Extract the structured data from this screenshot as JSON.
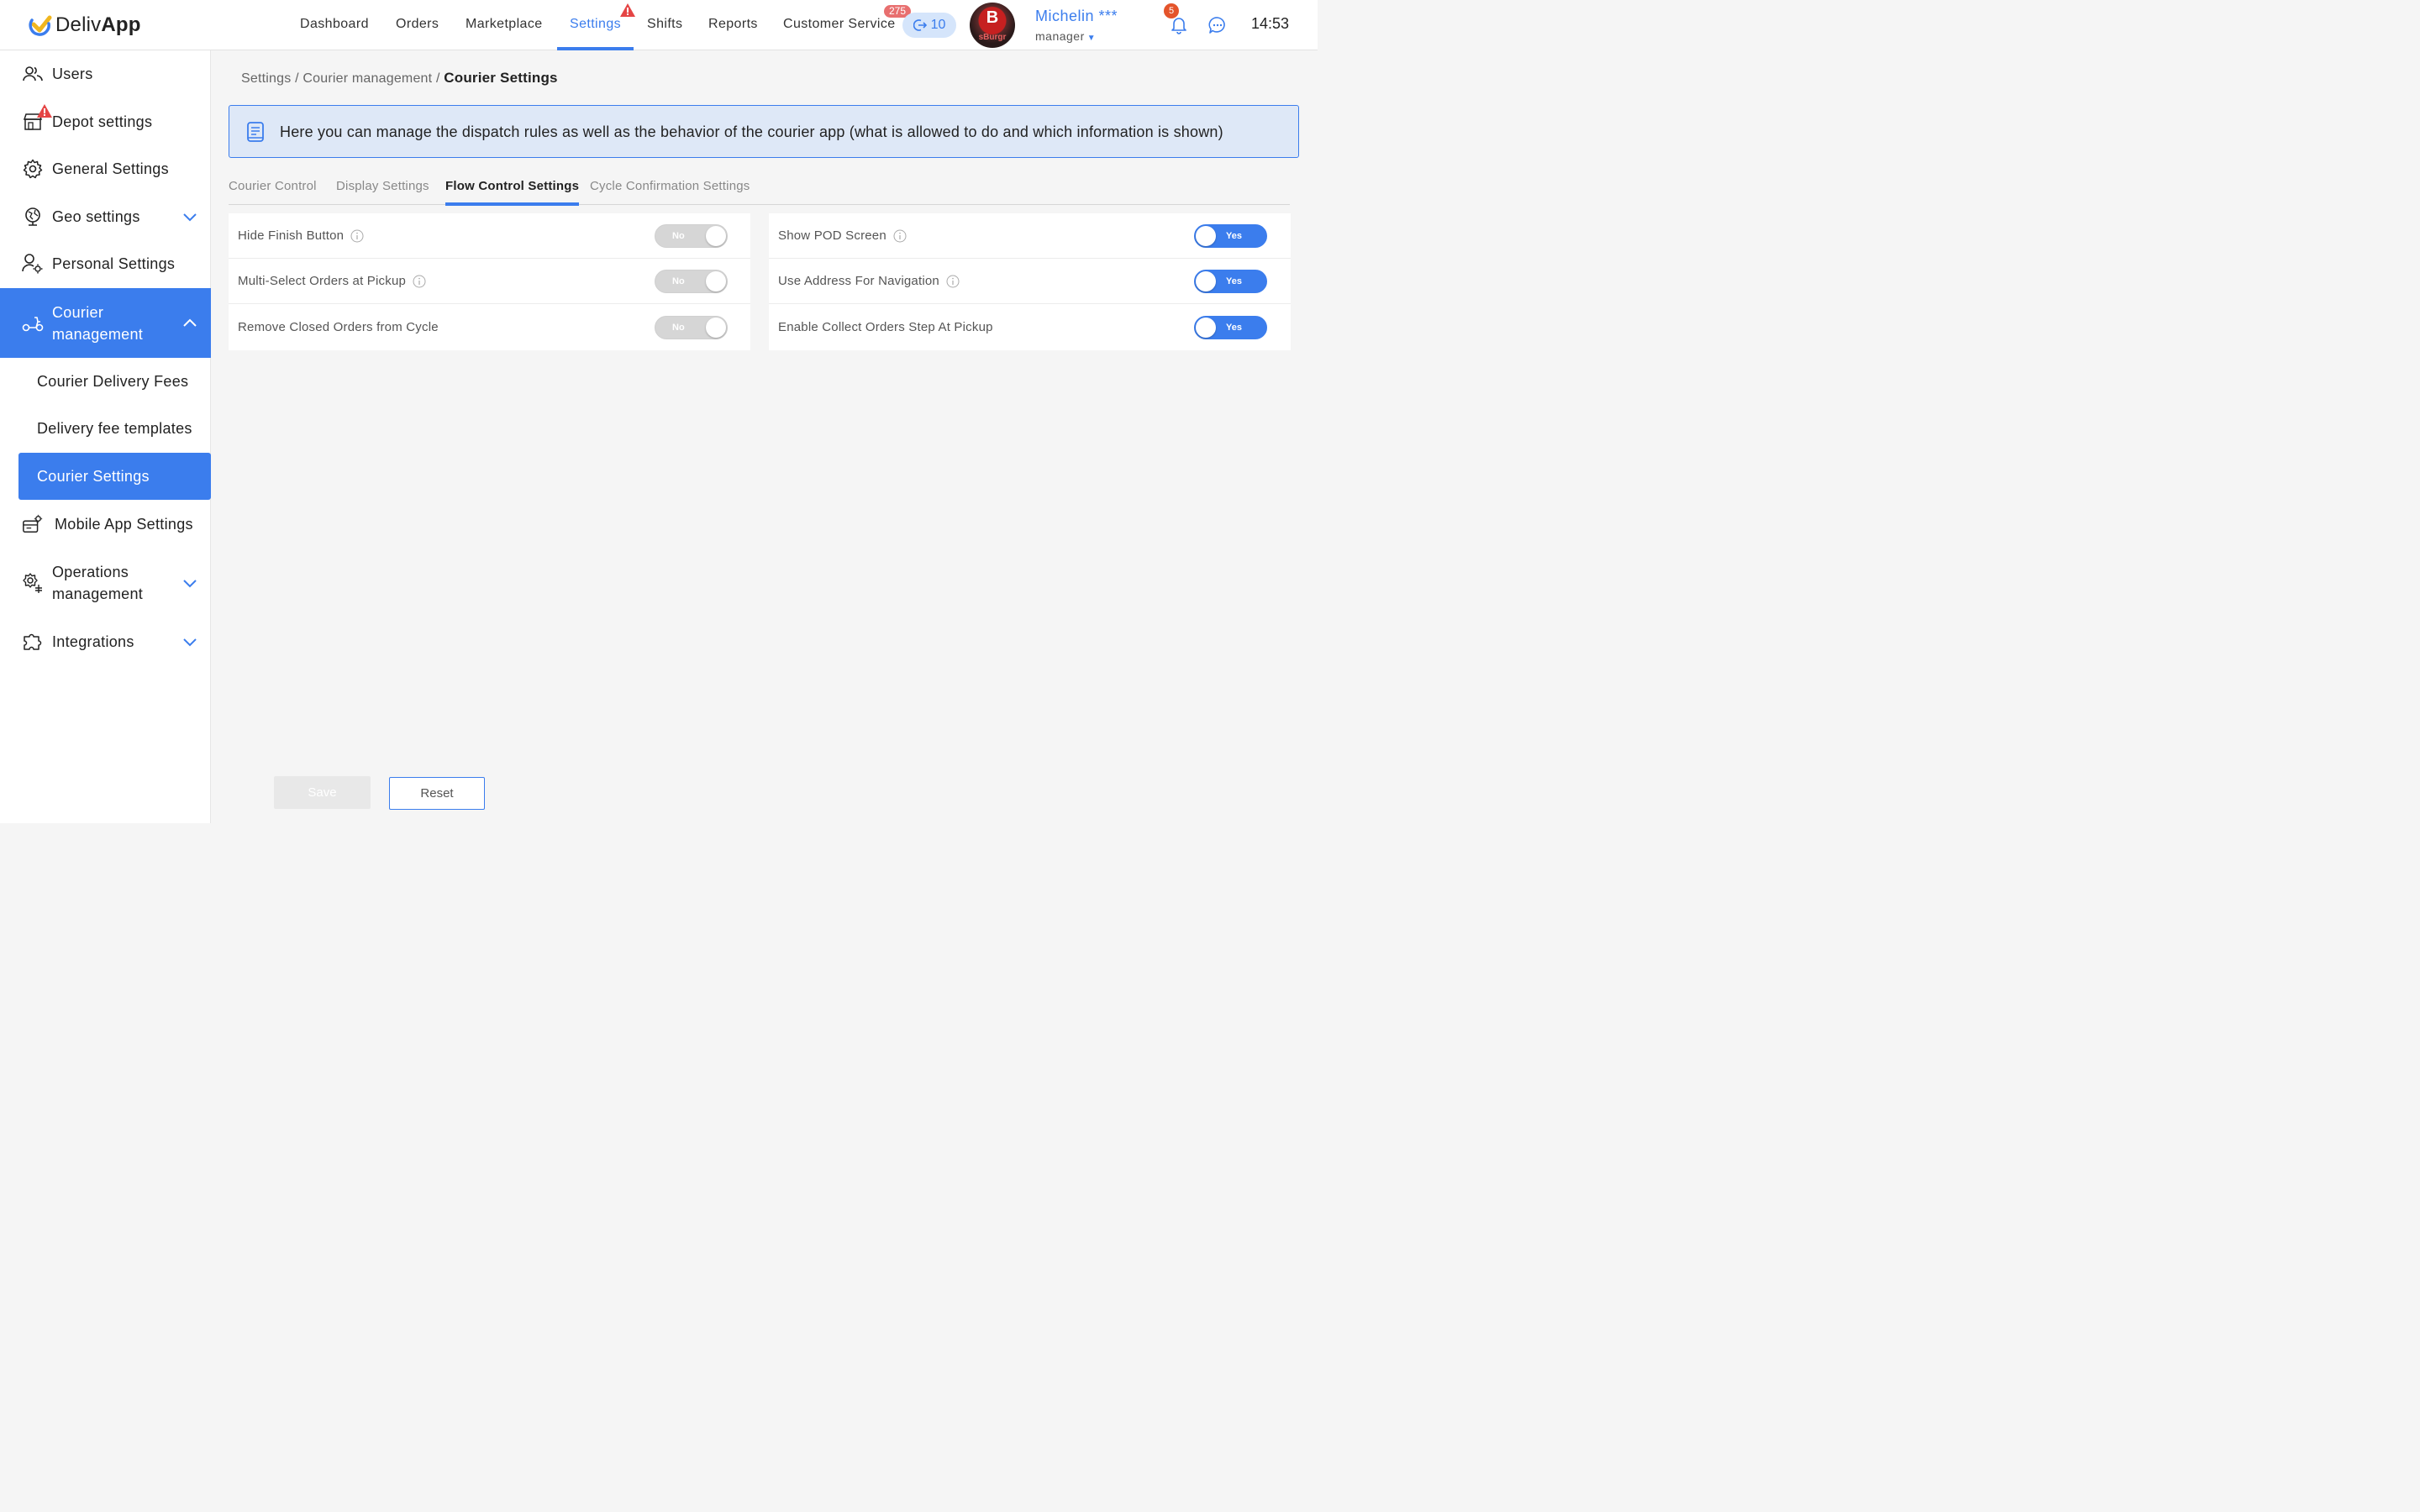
{
  "app": {
    "name_regular": "Deliv",
    "name_bold": "App",
    "time": "14:53"
  },
  "colors": {
    "accent": "#3b7ded",
    "warning": "#e54545",
    "badge": "#e86f6f"
  },
  "nav": [
    {
      "label": "Dashboard",
      "active": false
    },
    {
      "label": "Orders",
      "active": false
    },
    {
      "label": "Marketplace",
      "active": false
    },
    {
      "label": "Settings",
      "active": true,
      "alert_icon": "warning-icon"
    },
    {
      "label": "Shifts",
      "active": false
    },
    {
      "label": "Reports",
      "active": false
    },
    {
      "label": "Customer Service",
      "active": false,
      "badge": "275"
    }
  ],
  "cs_queue": {
    "icon": "logout-icon",
    "count": "10"
  },
  "user": {
    "avatar_letter": "B",
    "avatar_text": "sBurgr",
    "name": "Michelin ***",
    "role": "manager",
    "notification_count": "5"
  },
  "sidebar": {
    "items": [
      {
        "label": "Users",
        "icon": "users-icon"
      },
      {
        "label": "Depot settings",
        "icon": "store-icon",
        "alert": true
      },
      {
        "label": "General Settings",
        "icon": "gear-icon"
      },
      {
        "label": "Geo settings",
        "icon": "globe-icon",
        "expandable": true
      },
      {
        "label": "Personal Settings",
        "icon": "user-settings-icon"
      },
      {
        "label": "Courier management",
        "icon": "scooter-icon",
        "expanded": true,
        "active": true
      },
      {
        "label": "Mobile App Settings",
        "icon": "mobile-settings-icon"
      },
      {
        "label": "Operations management",
        "icon": "operations-icon",
        "expandable": true
      },
      {
        "label": "Integrations",
        "icon": "puzzle-icon",
        "expandable": true
      }
    ],
    "courier_sub": [
      {
        "label": "Courier Delivery Fees",
        "active": false
      },
      {
        "label": "Delivery fee templates",
        "active": false
      },
      {
        "label": "Courier Settings",
        "active": true
      }
    ]
  },
  "breadcrumb": {
    "part1": "Settings",
    "part2": "Courier management",
    "current": "Courier Settings",
    "separator": "/"
  },
  "info_banner": {
    "icon": "note-icon",
    "text": "Here you can manage the dispatch rules as well as the behavior of the courier app (what is allowed to do and which information is shown)"
  },
  "tabs": [
    {
      "label": "Courier Control",
      "active": false
    },
    {
      "label": "Display Settings",
      "active": false
    },
    {
      "label": "Flow Control Settings",
      "active": true
    },
    {
      "label": "Cycle Confirmation Settings",
      "active": false
    }
  ],
  "settings_left": [
    {
      "label": "Hide Finish Button",
      "info": true,
      "value": "No",
      "on": false
    },
    {
      "label": "Multi-Select Orders at Pickup",
      "info": true,
      "value": "No",
      "on": false
    },
    {
      "label": "Remove Closed Orders from Cycle",
      "info": false,
      "value": "No",
      "on": false
    }
  ],
  "settings_right": [
    {
      "label": "Show POD Screen",
      "info": true,
      "value": "Yes",
      "on": true
    },
    {
      "label": "Use Address For Navigation",
      "info": true,
      "value": "Yes",
      "on": true
    },
    {
      "label": "Enable Collect Orders Step At Pickup",
      "info": false,
      "value": "Yes",
      "on": true
    }
  ],
  "buttons": {
    "save": "Save",
    "reset": "Reset"
  }
}
